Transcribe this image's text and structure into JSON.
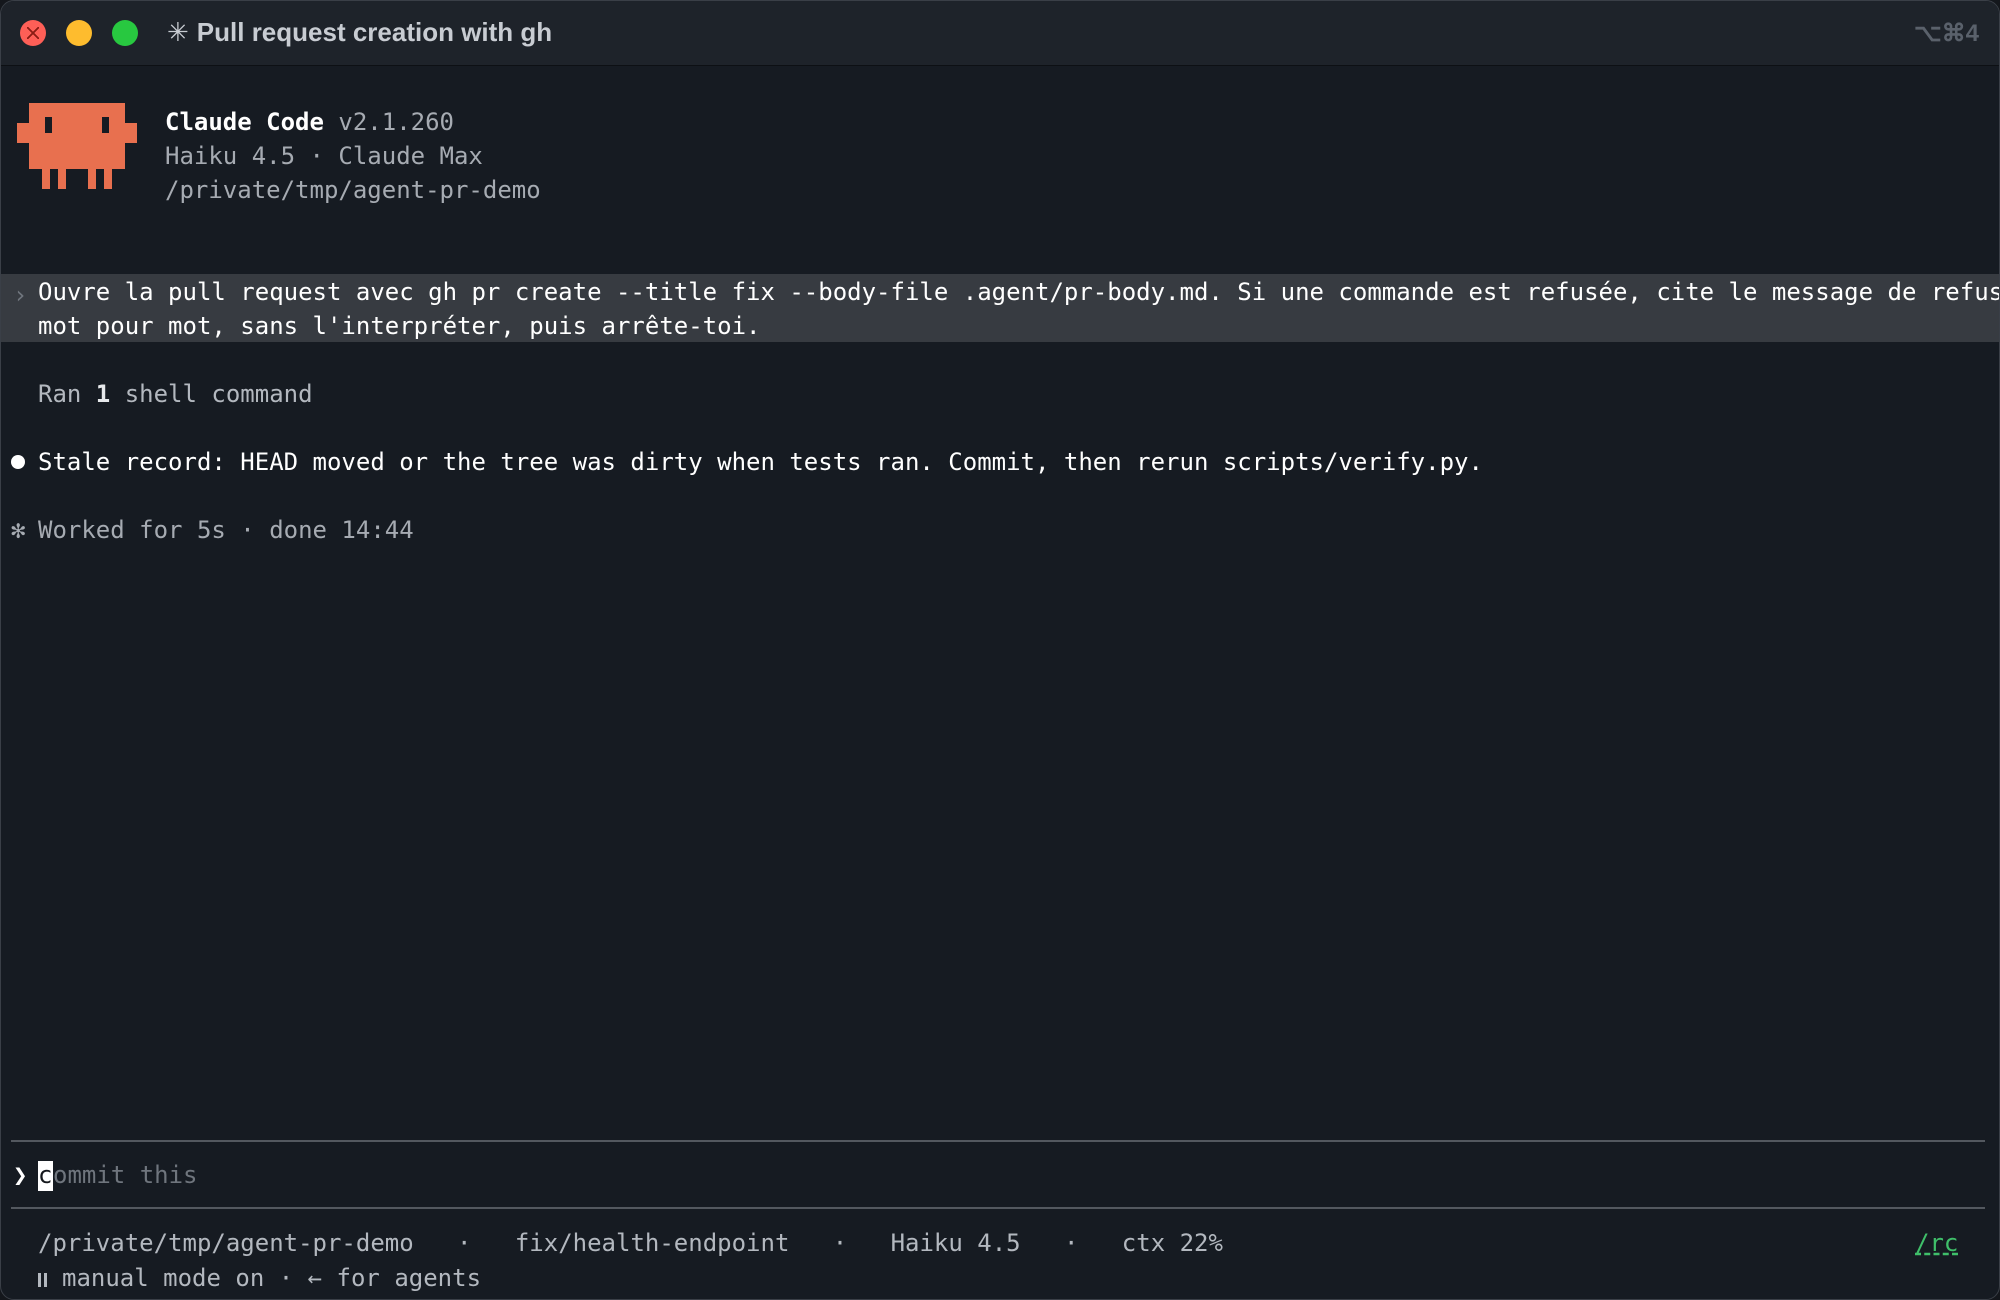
{
  "window": {
    "title": "Pull request creation with gh",
    "title_glyph": "✳",
    "shortcut": "⌥⌘4"
  },
  "banner": {
    "app_name": "Claude Code",
    "version": "v2.1.260",
    "model_line": "Haiku 4.5 · Claude Max",
    "cwd": "/private/tmp/agent-pr-demo",
    "mascot": "pixel-crab-icon",
    "mascot_color": "#e8704f"
  },
  "conversation": {
    "user_chevron": "›",
    "user_prompt_line1": "Ouvre la pull request avec gh pr create --title fix --body-file .agent/pr-body.md. Si une commande est refusée, cite le message de refus",
    "user_prompt_line2": "mot pour mot, sans l'interpréter, puis arrête-toi.",
    "tool_prefix": "Ran ",
    "tool_count": "1",
    "tool_suffix": " shell command",
    "assistant_message": "Stale record: HEAD moved or the tree was dirty when tests ran. Commit, then rerun scripts/verify.py.",
    "worked_glyph": "✻",
    "worked_text": "Worked for 5s · done 14:44"
  },
  "input": {
    "chevron": "❯",
    "cursor_char": "c",
    "placeholder_rest": "ommit this"
  },
  "statusbar": {
    "path": "/private/tmp/agent-pr-demo",
    "branch": "fix/health-endpoint",
    "model": "Haiku 4.5",
    "context": "ctx 22%",
    "separator": "·",
    "remote_link": "/rc",
    "mode_text": "manual mode on · ← for agents"
  },
  "colors": {
    "background": "#161b22",
    "prompt_highlight": "#373b41",
    "accent_green": "#3fbf6a",
    "mascot": "#e8704f"
  }
}
